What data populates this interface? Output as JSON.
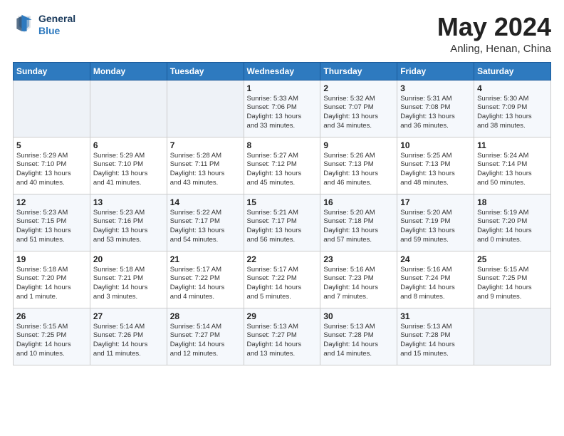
{
  "header": {
    "logo_line1": "General",
    "logo_line2": "Blue",
    "month": "May 2024",
    "location": "Anling, Henan, China"
  },
  "weekdays": [
    "Sunday",
    "Monday",
    "Tuesday",
    "Wednesday",
    "Thursday",
    "Friday",
    "Saturday"
  ],
  "weeks": [
    [
      {
        "day": "",
        "info": ""
      },
      {
        "day": "",
        "info": ""
      },
      {
        "day": "",
        "info": ""
      },
      {
        "day": "1",
        "info": "Sunrise: 5:33 AM\nSunset: 7:06 PM\nDaylight: 13 hours\nand 33 minutes."
      },
      {
        "day": "2",
        "info": "Sunrise: 5:32 AM\nSunset: 7:07 PM\nDaylight: 13 hours\nand 34 minutes."
      },
      {
        "day": "3",
        "info": "Sunrise: 5:31 AM\nSunset: 7:08 PM\nDaylight: 13 hours\nand 36 minutes."
      },
      {
        "day": "4",
        "info": "Sunrise: 5:30 AM\nSunset: 7:09 PM\nDaylight: 13 hours\nand 38 minutes."
      }
    ],
    [
      {
        "day": "5",
        "info": "Sunrise: 5:29 AM\nSunset: 7:10 PM\nDaylight: 13 hours\nand 40 minutes."
      },
      {
        "day": "6",
        "info": "Sunrise: 5:29 AM\nSunset: 7:10 PM\nDaylight: 13 hours\nand 41 minutes."
      },
      {
        "day": "7",
        "info": "Sunrise: 5:28 AM\nSunset: 7:11 PM\nDaylight: 13 hours\nand 43 minutes."
      },
      {
        "day": "8",
        "info": "Sunrise: 5:27 AM\nSunset: 7:12 PM\nDaylight: 13 hours\nand 45 minutes."
      },
      {
        "day": "9",
        "info": "Sunrise: 5:26 AM\nSunset: 7:13 PM\nDaylight: 13 hours\nand 46 minutes."
      },
      {
        "day": "10",
        "info": "Sunrise: 5:25 AM\nSunset: 7:13 PM\nDaylight: 13 hours\nand 48 minutes."
      },
      {
        "day": "11",
        "info": "Sunrise: 5:24 AM\nSunset: 7:14 PM\nDaylight: 13 hours\nand 50 minutes."
      }
    ],
    [
      {
        "day": "12",
        "info": "Sunrise: 5:23 AM\nSunset: 7:15 PM\nDaylight: 13 hours\nand 51 minutes."
      },
      {
        "day": "13",
        "info": "Sunrise: 5:23 AM\nSunset: 7:16 PM\nDaylight: 13 hours\nand 53 minutes."
      },
      {
        "day": "14",
        "info": "Sunrise: 5:22 AM\nSunset: 7:17 PM\nDaylight: 13 hours\nand 54 minutes."
      },
      {
        "day": "15",
        "info": "Sunrise: 5:21 AM\nSunset: 7:17 PM\nDaylight: 13 hours\nand 56 minutes."
      },
      {
        "day": "16",
        "info": "Sunrise: 5:20 AM\nSunset: 7:18 PM\nDaylight: 13 hours\nand 57 minutes."
      },
      {
        "day": "17",
        "info": "Sunrise: 5:20 AM\nSunset: 7:19 PM\nDaylight: 13 hours\nand 59 minutes."
      },
      {
        "day": "18",
        "info": "Sunrise: 5:19 AM\nSunset: 7:20 PM\nDaylight: 14 hours\nand 0 minutes."
      }
    ],
    [
      {
        "day": "19",
        "info": "Sunrise: 5:18 AM\nSunset: 7:20 PM\nDaylight: 14 hours\nand 1 minute."
      },
      {
        "day": "20",
        "info": "Sunrise: 5:18 AM\nSunset: 7:21 PM\nDaylight: 14 hours\nand 3 minutes."
      },
      {
        "day": "21",
        "info": "Sunrise: 5:17 AM\nSunset: 7:22 PM\nDaylight: 14 hours\nand 4 minutes."
      },
      {
        "day": "22",
        "info": "Sunrise: 5:17 AM\nSunset: 7:22 PM\nDaylight: 14 hours\nand 5 minutes."
      },
      {
        "day": "23",
        "info": "Sunrise: 5:16 AM\nSunset: 7:23 PM\nDaylight: 14 hours\nand 7 minutes."
      },
      {
        "day": "24",
        "info": "Sunrise: 5:16 AM\nSunset: 7:24 PM\nDaylight: 14 hours\nand 8 minutes."
      },
      {
        "day": "25",
        "info": "Sunrise: 5:15 AM\nSunset: 7:25 PM\nDaylight: 14 hours\nand 9 minutes."
      }
    ],
    [
      {
        "day": "26",
        "info": "Sunrise: 5:15 AM\nSunset: 7:25 PM\nDaylight: 14 hours\nand 10 minutes."
      },
      {
        "day": "27",
        "info": "Sunrise: 5:14 AM\nSunset: 7:26 PM\nDaylight: 14 hours\nand 11 minutes."
      },
      {
        "day": "28",
        "info": "Sunrise: 5:14 AM\nSunset: 7:27 PM\nDaylight: 14 hours\nand 12 minutes."
      },
      {
        "day": "29",
        "info": "Sunrise: 5:13 AM\nSunset: 7:27 PM\nDaylight: 14 hours\nand 13 minutes."
      },
      {
        "day": "30",
        "info": "Sunrise: 5:13 AM\nSunset: 7:28 PM\nDaylight: 14 hours\nand 14 minutes."
      },
      {
        "day": "31",
        "info": "Sunrise: 5:13 AM\nSunset: 7:28 PM\nDaylight: 14 hours\nand 15 minutes."
      },
      {
        "day": "",
        "info": ""
      }
    ]
  ]
}
